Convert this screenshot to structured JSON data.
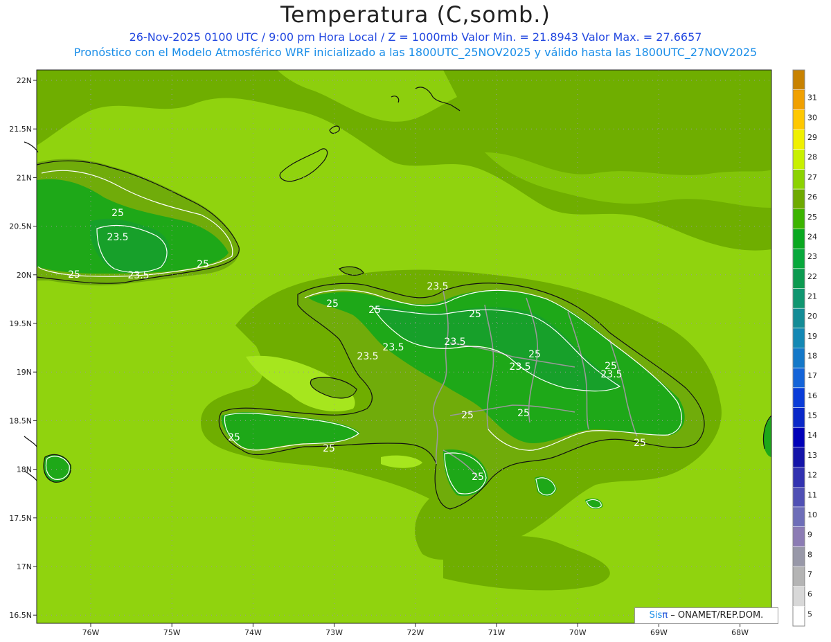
{
  "header": {
    "title": "Temperatura (C,somb.)",
    "line1": "26-Nov-2025  0100 UTC / 9:00 pm Hora Local / Z = 1000mb   Valor Min. = 21.8943  Valor Max. = 27.6657",
    "line2": "Pronóstico con el Modelo Atmosférico WRF inicializado a las 1800UTC_25NOV2025 y válido hasta las  1800UTC_27NOV2025"
  },
  "axes": {
    "lat_labels": [
      "22N",
      "21.5N",
      "21N",
      "20.5N",
      "20N",
      "19.5N",
      "19N",
      "18.5N",
      "18N",
      "17.5N",
      "17N",
      "16.5N"
    ],
    "lon_labels": [
      "76W",
      "75W",
      "74W",
      "73W",
      "72W",
      "71W",
      "70W",
      "69W",
      "68W"
    ]
  },
  "contour_labels": [
    "25",
    "23.5",
    "23.5",
    "25",
    "25",
    "25",
    "25",
    "23.5",
    "23.5",
    "25",
    "23.5",
    "23.5",
    "25",
    "23.5",
    "25",
    "23.5",
    "25",
    "25",
    "25",
    "25",
    "25",
    "25"
  ],
  "colorbar": {
    "levels": [
      "5",
      "6",
      "7",
      "8",
      "9",
      "10",
      "11",
      "12",
      "13",
      "14",
      "15",
      "16",
      "17",
      "18",
      "19",
      "20",
      "21",
      "22",
      "23",
      "24",
      "25",
      "26",
      "27",
      "28",
      "29",
      "30",
      "31"
    ],
    "colors": [
      "#ffffff",
      "#d8d8d8",
      "#b4b4b4",
      "#9898a8",
      "#8c7cb4",
      "#6e6eb8",
      "#5050b4",
      "#3232b0",
      "#1414a8",
      "#0000b8",
      "#0a28c8",
      "#0a3cd8",
      "#1464d8",
      "#1478c8",
      "#1488b4",
      "#148c96",
      "#109670",
      "#0c9a50",
      "#08a83c",
      "#0aa820",
      "#3cb400",
      "#6eaa00",
      "#8cd200",
      "#c8f000",
      "#f0f000",
      "#ffc800",
      "#f0a000",
      "#c88200"
    ]
  },
  "field_colors": {
    "sea": "#90d30e",
    "sea_warm": "#a6e61e",
    "band_26": "#6fae00",
    "land_25": "#70ac0a",
    "land_24": "#1ea818",
    "land_23": "#17a02a"
  },
  "credit": {
    "sis": "Sis",
    "pi": "π",
    "rest": "– ONAMET/REP.DOM."
  }
}
